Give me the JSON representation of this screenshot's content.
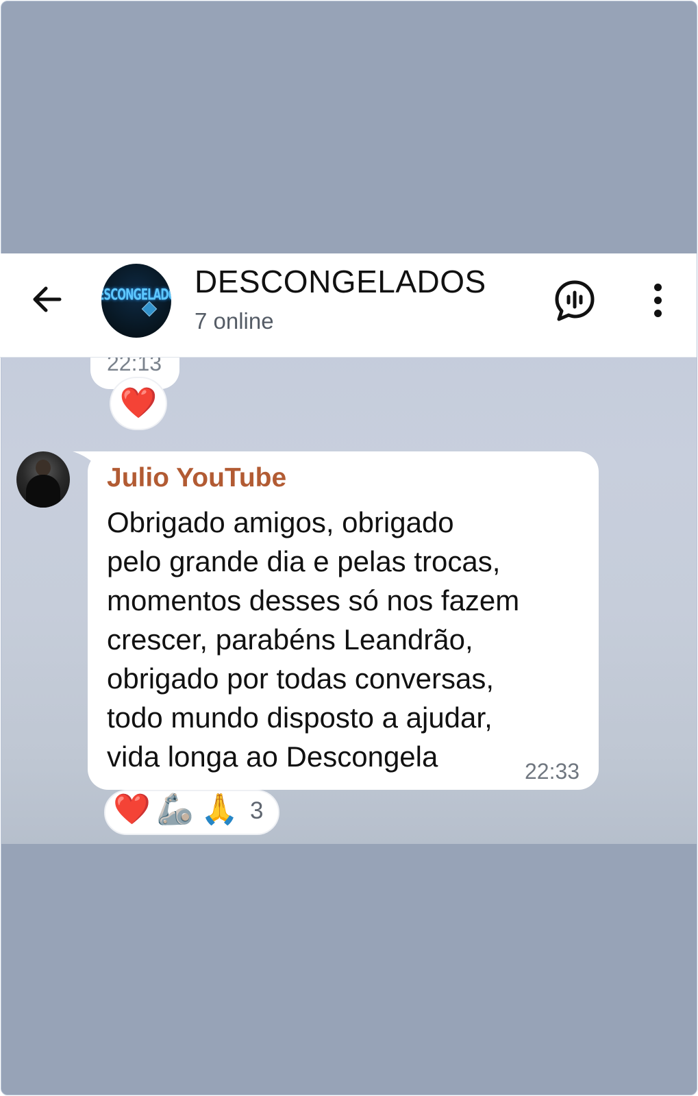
{
  "chat": {
    "group_name": "DESCONGELADOS",
    "status": "7 online",
    "group_avatar_text": "DESCONGELADOS"
  },
  "icons": {
    "back": "arrow-left-icon",
    "voice_chat": "voice-chat-icon",
    "menu": "more-vertical-icon"
  },
  "previous_message": {
    "time": "22:13",
    "reaction": "❤️"
  },
  "message": {
    "sender": "Julio YouTube",
    "text": "Obrigado amigos, obrigado\npelo grande dia e pelas trocas,\nmomentos desses só nos fazem\ncrescer, parabéns Leandrão,\nobrigado por todas conversas,\ntodo mundo disposto a ajudar,\nvida longa ao Descongela",
    "time": "22:33",
    "sender_color": "#b25b33"
  },
  "reactions": {
    "items": [
      "❤️",
      "🦾",
      "🙏"
    ],
    "count": "3"
  },
  "colors": {
    "backdrop": "#97a3b7",
    "header_bg": "#ffffff",
    "bubble_bg": "#ffffff"
  }
}
